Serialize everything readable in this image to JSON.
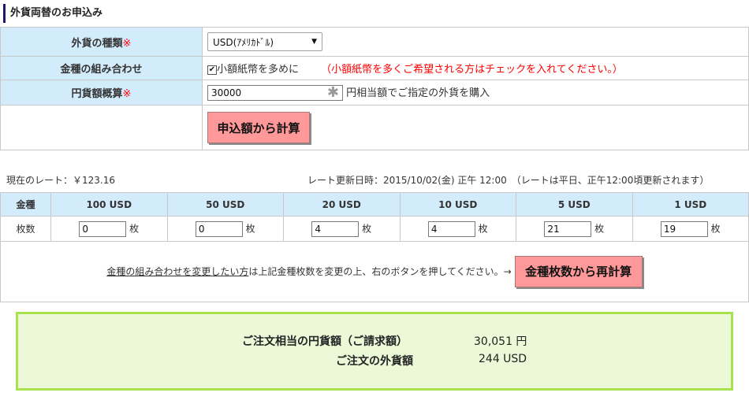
{
  "section_title": "外貨両替のお申込み",
  "form": {
    "currency_type_label": "外貨の種類",
    "required_mark": "※",
    "currency_selected": "USD(ｱﾒﾘｶﾄﾞﾙ)",
    "denomination_label": "金種の組み合わせ",
    "small_bills_label": "小額紙幣を多めに",
    "small_bills_checked": true,
    "small_bills_note": "（小額紙幣を多くご希望される方はチェックを入れてください。）",
    "yen_amount_label": "円貨額概算",
    "yen_amount_value": "30000",
    "yen_amount_note": "円相当額でご指定の外貨を購入",
    "calc_button": "申込額から計算"
  },
  "rate": {
    "current_rate": "現在のレート：￥123.16",
    "update_time": "レート更新日時：2015/10/02(金) 正午 12:00　（レートは平日、正午12:00頃更新されます）"
  },
  "denominations": {
    "header_label": "金種",
    "row_label": "枚数",
    "unit": "枚",
    "columns": [
      {
        "name": "100 USD",
        "qty": "0"
      },
      {
        "name": "50 USD",
        "qty": "0"
      },
      {
        "name": "20 USD",
        "qty": "4"
      },
      {
        "name": "10 USD",
        "qty": "4"
      },
      {
        "name": "5 USD",
        "qty": "21"
      },
      {
        "name": "1 USD",
        "qty": "19"
      }
    ]
  },
  "recalc": {
    "link_text": "金種の組み合わせを変更したい方",
    "text": "は上記金種枚数を変更の上、右のボタンを押してください。→",
    "button": "金種枚数から再計算"
  },
  "summary": {
    "yen_label": "ご注文相当の円貨額（ご請求額）",
    "yen_value": "30,051 円",
    "foreign_label": "ご注文の外貨額",
    "foreign_value": "244 USD"
  },
  "colors": {
    "label_bg": "#d3ecfb",
    "button_pink": "#ff9999",
    "required_red": "#ff0000",
    "summary_bg": "#ebf9d8",
    "summary_border": "#a9e24f"
  }
}
